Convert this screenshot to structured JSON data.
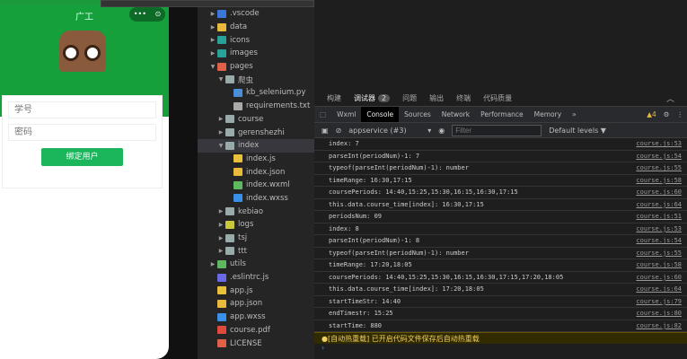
{
  "phone": {
    "title": "广工",
    "capsule_more": "•••",
    "capsule_close": "⊙",
    "student_id_placeholder": "学号",
    "password_placeholder": "密码",
    "bind_button": "绑定用户"
  },
  "explorer": {
    "items": [
      {
        "label": ".vscode",
        "type": "folder",
        "color": "#3a78d8",
        "depth": 0,
        "arrow": "▶"
      },
      {
        "label": "data",
        "type": "folder",
        "color": "#e8b93a",
        "depth": 0,
        "arrow": "▶"
      },
      {
        "label": "icons",
        "type": "folder",
        "color": "#2aa198",
        "depth": 0,
        "arrow": "▶"
      },
      {
        "label": "images",
        "type": "folder",
        "color": "#2aa198",
        "depth": 0,
        "arrow": "▶"
      },
      {
        "label": "pages",
        "type": "folder",
        "color": "#e0604a",
        "depth": 0,
        "arrow": "▼"
      },
      {
        "label": "爬虫",
        "type": "folder",
        "color": "#9aa",
        "depth": 1,
        "arrow": "▼"
      },
      {
        "label": "kb_selenium.py",
        "type": "file",
        "color": "#4a8fd8",
        "depth": 2,
        "arrow": ""
      },
      {
        "label": "requirements.txt",
        "type": "file",
        "color": "#aaa",
        "depth": 2,
        "arrow": ""
      },
      {
        "label": "course",
        "type": "folder",
        "color": "#9aa",
        "depth": 1,
        "arrow": "▶"
      },
      {
        "label": "gerenshezhi",
        "type": "folder",
        "color": "#9aa",
        "depth": 1,
        "arrow": "▶"
      },
      {
        "label": "index",
        "type": "folder",
        "color": "#9aa",
        "depth": 1,
        "arrow": "▼",
        "selected": true
      },
      {
        "label": "index.js",
        "type": "file",
        "color": "#e8c03a",
        "depth": 2,
        "arrow": ""
      },
      {
        "label": "index.json",
        "type": "file",
        "color": "#e8b93a",
        "depth": 2,
        "arrow": ""
      },
      {
        "label": "index.wxml",
        "type": "file",
        "color": "#5fb85f",
        "depth": 2,
        "arrow": ""
      },
      {
        "label": "index.wxss",
        "type": "file",
        "color": "#3a8fe8",
        "depth": 2,
        "arrow": ""
      },
      {
        "label": "kebiao",
        "type": "folder",
        "color": "#9aa",
        "depth": 1,
        "arrow": "▶"
      },
      {
        "label": "logs",
        "type": "folder",
        "color": "#c8c83a",
        "depth": 1,
        "arrow": "▶"
      },
      {
        "label": "tsj",
        "type": "folder",
        "color": "#9aa",
        "depth": 1,
        "arrow": "▶"
      },
      {
        "label": "ttt",
        "type": "folder",
        "color": "#9aa",
        "depth": 1,
        "arrow": "▶"
      },
      {
        "label": "utils",
        "type": "folder",
        "color": "#5fb85f",
        "depth": 0,
        "arrow": "▶"
      },
      {
        "label": ".eslintrc.js",
        "type": "file",
        "color": "#6a6ae8",
        "depth": 0,
        "arrow": ""
      },
      {
        "label": "app.js",
        "type": "file",
        "color": "#e8c03a",
        "depth": 0,
        "arrow": ""
      },
      {
        "label": "app.json",
        "type": "file",
        "color": "#e8b93a",
        "depth": 0,
        "arrow": ""
      },
      {
        "label": "app.wxss",
        "type": "file",
        "color": "#3a8fe8",
        "depth": 0,
        "arrow": ""
      },
      {
        "label": "course.pdf",
        "type": "file",
        "color": "#e04a3a",
        "depth": 0,
        "arrow": ""
      },
      {
        "label": "LICENSE",
        "type": "file",
        "color": "#e0604a",
        "depth": 0,
        "arrow": ""
      }
    ]
  },
  "panel_tabs": [
    {
      "label": "构建"
    },
    {
      "label": "调试器",
      "badge": "2"
    },
    {
      "label": "问题"
    },
    {
      "label": "输出"
    },
    {
      "label": "终端"
    },
    {
      "label": "代码质量"
    }
  ],
  "devtools_tabs": [
    "Wxml",
    "Console",
    "Sources",
    "Network",
    "Performance",
    "Memory",
    "»"
  ],
  "active_devtools_tab": "Console",
  "warning_count": "4",
  "toolbar": {
    "context": "appservice (#3)",
    "filter_placeholder": "Filter",
    "levels": "Default levels ▼"
  },
  "logs": [
    {
      "text": "index: 7",
      "src": "course.js:53"
    },
    {
      "text": "parseInt(periodNum)-1: 7",
      "src": "course.js:54"
    },
    {
      "text": "typeof(parseInt(periodNum)-1): number",
      "src": "course.js:55"
    },
    {
      "text": "timeRange: 16:30,17:15",
      "src": "course.js:58"
    },
    {
      "text": "coursePeriods: 14:40,15:25,15:30,16:15,16:30,17:15",
      "src": "course.js:60"
    },
    {
      "text": "this.data.course_time[index]: 16:30,17:15",
      "src": "course.js:64"
    },
    {
      "text": "periodsNum: 09",
      "src": "course.js:51"
    },
    {
      "text": "index: 8",
      "src": "course.js:53"
    },
    {
      "text": "parseInt(periodNum)-1: 8",
      "src": "course.js:54"
    },
    {
      "text": "typeof(parseInt(periodNum)-1): number",
      "src": "course.js:55"
    },
    {
      "text": "timeRange: 17:20,18:05",
      "src": "course.js:58"
    },
    {
      "text": "coursePeriods: 14:40,15:25,15:30,16:15,16:30,17:15,17:20,18:05",
      "src": "course.js:60"
    },
    {
      "text": "this.data.course_time[index]: 17:20,18:05",
      "src": "course.js:64"
    },
    {
      "text": "startTimeStr: 14:40",
      "src": "course.js:79"
    },
    {
      "text": "endTimestr: 15:25",
      "src": "course.js:80"
    },
    {
      "text": "startTime: 880",
      "src": "course.js:82"
    }
  ],
  "warning_message": "[自动热重载] 已开启代码文件保存后自动热重载",
  "prompt": "›"
}
